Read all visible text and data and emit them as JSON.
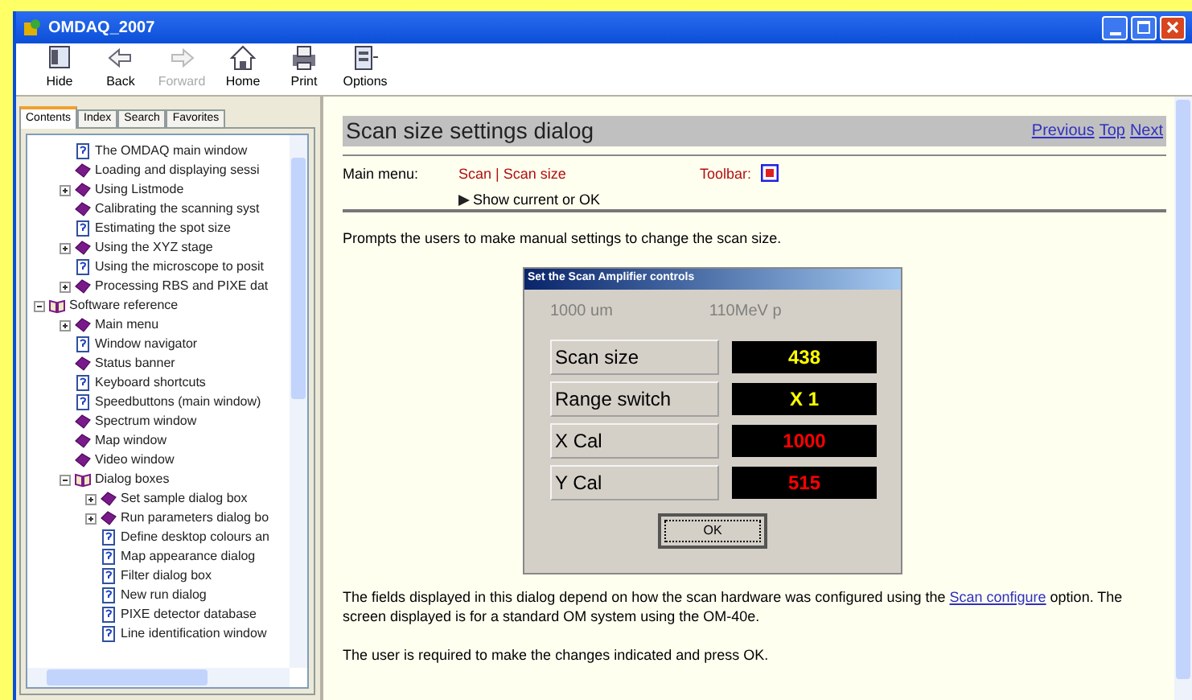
{
  "window": {
    "title": "OMDAQ_2007"
  },
  "toolbar": [
    {
      "label": "Hide",
      "disabled": false
    },
    {
      "label": "Back",
      "disabled": false
    },
    {
      "label": "Forward",
      "disabled": true
    },
    {
      "label": "Home",
      "disabled": false
    },
    {
      "label": "Print",
      "disabled": false
    },
    {
      "label": "Options",
      "disabled": false
    }
  ],
  "tabs": [
    {
      "label": "Contents",
      "selected": true
    },
    {
      "label": "Index",
      "selected": false
    },
    {
      "label": "Search",
      "selected": false
    },
    {
      "label": "Favorites",
      "selected": false
    }
  ],
  "tree": [
    {
      "children": [
        {
          "label": "The OMDAQ main window",
          "kind": "page"
        },
        {
          "label": "Loading and displaying sessi",
          "kind": "book"
        },
        {
          "label": "Using Listmode",
          "kind": "book",
          "expanded": false
        },
        {
          "label": "Calibrating the scanning syst",
          "kind": "book"
        },
        {
          "label": "Estimating the spot size",
          "kind": "page"
        },
        {
          "label": "Using the XYZ stage",
          "kind": "book",
          "expanded": false
        },
        {
          "label": "Using the microscope to posit",
          "kind": "page"
        },
        {
          "label": "Processing RBS and PIXE dat",
          "kind": "book",
          "expanded": false
        }
      ]
    },
    {
      "label": "Software reference",
      "kind": "openbook",
      "expanded": true,
      "children": [
        {
          "label": "Main menu",
          "kind": "book",
          "expanded": false
        },
        {
          "label": "Window navigator",
          "kind": "page"
        },
        {
          "label": "Status banner",
          "kind": "book"
        },
        {
          "label": "Keyboard shortcuts",
          "kind": "page"
        },
        {
          "label": "Speedbuttons (main window)",
          "kind": "page"
        },
        {
          "label": "Spectrum window",
          "kind": "book"
        },
        {
          "label": "Map window",
          "kind": "book"
        },
        {
          "label": "Video window",
          "kind": "book"
        },
        {
          "label": "Dialog boxes",
          "kind": "openbook",
          "expanded": true,
          "children": [
            {
              "label": "Set sample dialog box",
              "kind": "book",
              "expanded": false
            },
            {
              "label": "Run parameters dialog bo",
              "kind": "book",
              "expanded": false
            },
            {
              "label": "Define desktop colours an",
              "kind": "page"
            },
            {
              "label": "Map appearance dialog",
              "kind": "page"
            },
            {
              "label": "Filter dialog box",
              "kind": "page"
            },
            {
              "label": "New run dialog",
              "kind": "page"
            },
            {
              "label": "PIXE detector database",
              "kind": "page"
            },
            {
              "label": "Line identification window",
              "kind": "page"
            }
          ]
        }
      ]
    }
  ],
  "topic": {
    "heading": "Scan size settings dialog",
    "nav": [
      "Previous",
      "Top",
      "Next"
    ],
    "main_menu_label": "Main menu:",
    "main_menu_path": "Scan | Scan size",
    "main_menu_note": "Show current or OK",
    "toolbar_label": "Toolbar:",
    "intro": "Prompts the users to make manual settings to change the scan size.",
    "dialog": {
      "title": "Set the Scan Amplifier controls",
      "info": [
        {
          "text": "1000 um",
          "disabled": true
        },
        {
          "text": "110MeV p",
          "disabled": true
        }
      ],
      "rows": [
        {
          "label": "Scan size",
          "value": "438",
          "kind": "setting"
        },
        {
          "label": "Range switch",
          "value": "X 1",
          "kind": "setting"
        },
        {
          "label": "X Cal",
          "value": "1000",
          "kind": "calibration"
        },
        {
          "label": "Y Cal",
          "value": "515",
          "kind": "calibration"
        }
      ],
      "button": "OK"
    },
    "para1": {
      "before": "The fields displayed in this dialog depend on how the scan hardware was configured using the ",
      "link": "Scan configure",
      "after": " option.  The screen displayed is for a standard OM system using the OM-40e."
    },
    "para2": "The user is required to make the changes indicated and press OK."
  }
}
